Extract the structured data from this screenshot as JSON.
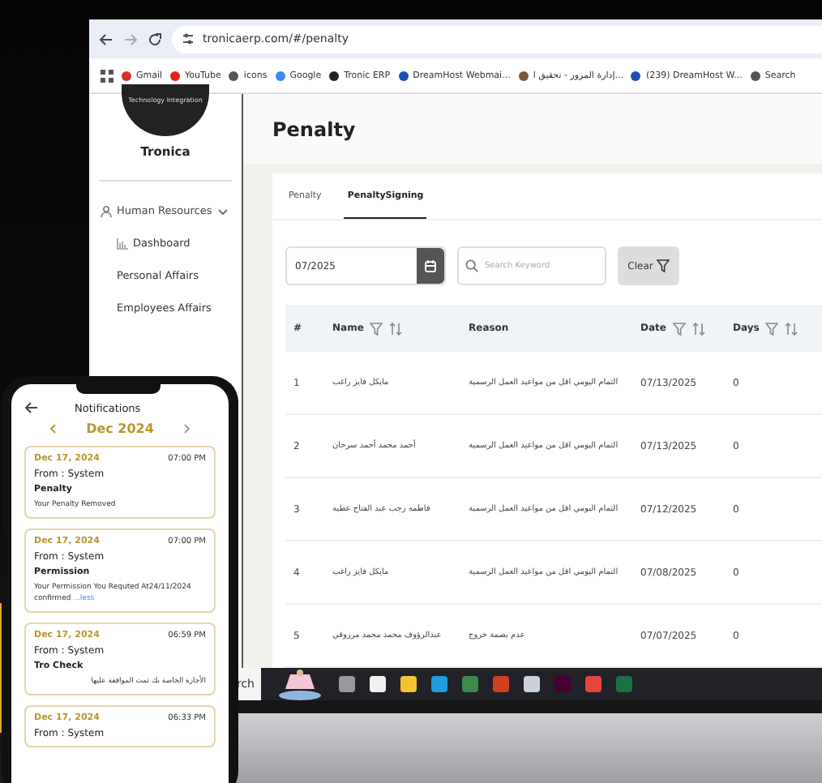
{
  "browser": {
    "url": "tronicaerp.com/#/penalty",
    "bookmarks": [
      {
        "label": "Gmail"
      },
      {
        "label": "YouTube"
      },
      {
        "label": "icons"
      },
      {
        "label": "Google"
      },
      {
        "label": "Tronic ERP"
      },
      {
        "label": "DreamHost Webmai..."
      },
      {
        "label": "إدارة المرور - تحقيق ا..."
      },
      {
        "label": "(239) DreamHost W..."
      },
      {
        "label": "Search"
      }
    ]
  },
  "sidebar": {
    "logo_caption": "Technology Integration",
    "brand": "Tronica",
    "items": [
      {
        "label": "Human Resources",
        "expanded": true,
        "children": [
          {
            "label": "Dashboard"
          },
          {
            "label": "Personal Affairs"
          },
          {
            "label": "Employees Affairs"
          }
        ]
      }
    ]
  },
  "page": {
    "title": "Penalty"
  },
  "tabs": [
    {
      "label": "Penalty",
      "selected": false
    },
    {
      "label": "PenaltySigning",
      "selected": true
    }
  ],
  "filters": {
    "month": "07/2025",
    "search_placeholder": "Search Keyword",
    "clear": "Clear"
  },
  "table": {
    "columns": [
      {
        "label": "#",
        "kind": "plain"
      },
      {
        "label": "Name",
        "kind": "filterable"
      },
      {
        "label": "Reason",
        "kind": "plain"
      },
      {
        "label": "Date",
        "kind": "filterable"
      },
      {
        "label": "Days",
        "kind": "filterable"
      }
    ],
    "rows": [
      [
        "1",
        "مايكل فايز راغب",
        "التمام اليومي اقل من مواعيد العمل الرسمية",
        "07/13/2025",
        "0"
      ],
      [
        "2",
        "أحمد محمد أحمد سرحان",
        "التمام اليومي اقل من مواعيد العمل الرسمية",
        "07/13/2025",
        "0"
      ],
      [
        "3",
        "فاطمه رجب عبد الفتاح عطيه",
        "التمام اليومي اقل من مواعيد العمل الرسمية",
        "07/12/2025",
        "0"
      ],
      [
        "4",
        "مايكل فايز راغب",
        "التمام اليومي اقل من مواعيد العمل الرسمية",
        "07/08/2025",
        "0"
      ],
      [
        "5",
        "عبدالرؤوف محمد محمد مرزوقي",
        "عدم بصمة خروج",
        "07/07/2025",
        "0"
      ]
    ]
  },
  "taskbar": {
    "search": "rch"
  },
  "phone": {
    "title": "Notifications",
    "month": "Dec 2024",
    "cards": [
      {
        "date": "Dec 17, 2024",
        "time": "07:00 PM",
        "from": "From : System",
        "title": "Penalty",
        "body": "Your Penalty Removed"
      },
      {
        "date": "Dec 17, 2024",
        "time": "07:00 PM",
        "from": "From : System",
        "title": "Permission",
        "body": "Your Permission You Requted At24/11/2024 confirmed",
        "link": "...less"
      },
      {
        "date": "Dec 17, 2024",
        "time": "06:59 PM",
        "from": "From : System",
        "title": "Tro Check",
        "body": "الأجازة الخاصة بك تمت الموافقة عليها"
      },
      {
        "date": "Dec 17, 2024",
        "time": "06:33 PM",
        "from": "From : System"
      }
    ]
  }
}
